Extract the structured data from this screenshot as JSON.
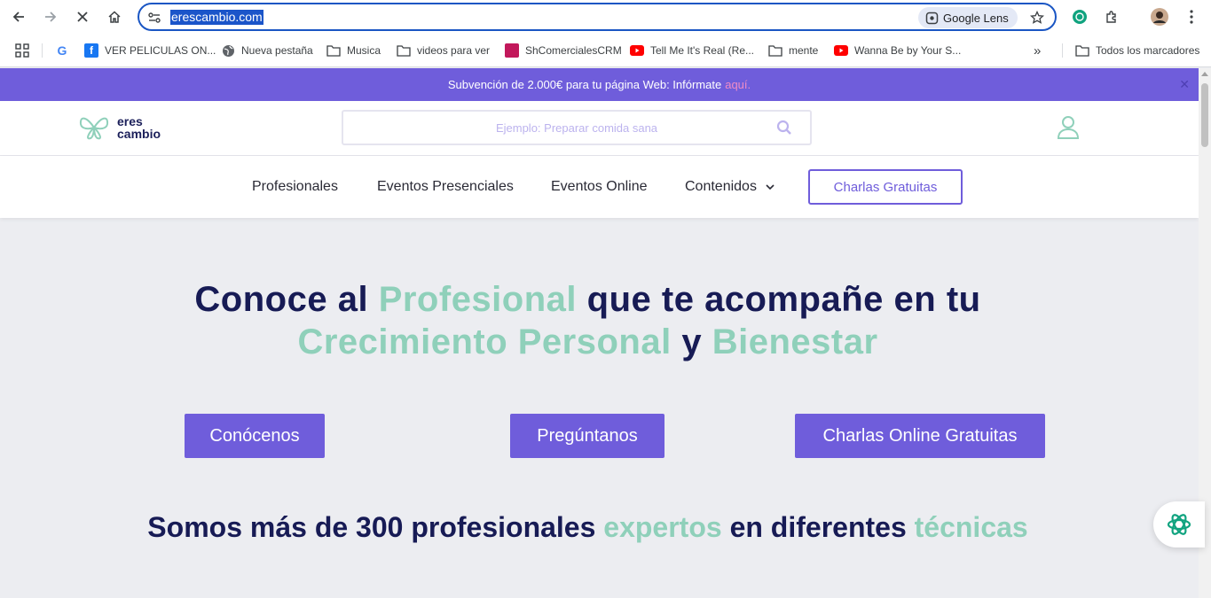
{
  "browser": {
    "url": "erescambio.com",
    "lens_label": "Google Lens",
    "bookmarks": [
      {
        "label": "VER PELICULAS ON..."
      },
      {
        "label": "Nueva pestaña"
      },
      {
        "label": "Musica"
      },
      {
        "label": "videos para ver"
      },
      {
        "label": "ShComercialesCRM"
      },
      {
        "label": "Tell Me It's Real (Re..."
      },
      {
        "label": "mente"
      },
      {
        "label": "Wanna Be by Your S..."
      }
    ],
    "all_bookmarks": "Todos los marcadores"
  },
  "announcement": {
    "text": "Subvención de 2.000€ para tu página Web: Infórmate",
    "link": "aquí."
  },
  "header": {
    "logo_line1": "eres",
    "logo_line2": "cambio",
    "search_placeholder": "Ejemplo: Preparar comida sana"
  },
  "nav": {
    "items": [
      "Profesionales",
      "Eventos Presenciales",
      "Eventos Online",
      "Contenidos"
    ],
    "cta": "Charlas Gratuitas"
  },
  "hero": {
    "line1": {
      "a": "Conoce al",
      "b": "Profesional",
      "c": "que te acompañe en tu"
    },
    "line2": {
      "a": "Crecimiento Personal",
      "b": "y",
      "c": "Bienestar"
    },
    "buttons": [
      "Conócenos",
      "Pregúntanos",
      "Charlas Online Gratuitas"
    ]
  },
  "subtitle": {
    "a": "Somos más de 300 profesionales",
    "b": "expertos",
    "c": "en diferentes",
    "d": "técnicas"
  },
  "colors": {
    "purple": "#6F5DDB",
    "mint": "#8FD0BA",
    "navy": "#171B55",
    "pink": "#F08CC6"
  }
}
